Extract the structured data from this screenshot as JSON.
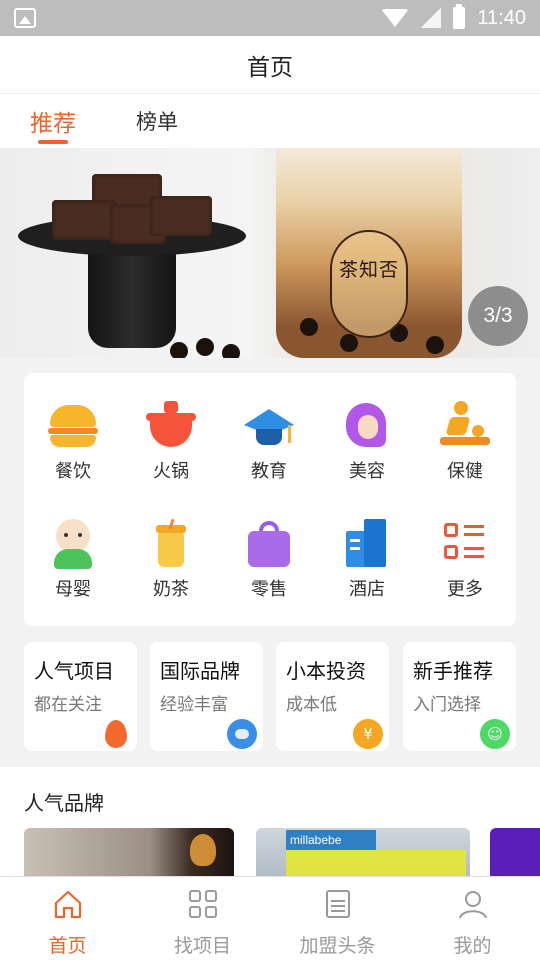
{
  "status_bar": {
    "time": "11:40",
    "icons": [
      "image-icon",
      "wifi-icon",
      "no-signal-icon",
      "battery-charging-icon"
    ]
  },
  "header": {
    "title": "首页"
  },
  "tabs": [
    {
      "label": "推荐",
      "active": true
    },
    {
      "label": "榜单",
      "active": false
    }
  ],
  "banner": {
    "indicator": "3/3",
    "cup_text": "茶知否"
  },
  "categories": [
    {
      "label": "餐饮",
      "icon": "burger-icon"
    },
    {
      "label": "火锅",
      "icon": "hotpot-icon"
    },
    {
      "label": "教育",
      "icon": "graduation-cap-icon"
    },
    {
      "label": "美容",
      "icon": "beauty-icon"
    },
    {
      "label": "保健",
      "icon": "massage-icon"
    },
    {
      "label": "母婴",
      "icon": "baby-icon"
    },
    {
      "label": "奶茶",
      "icon": "milk-tea-icon"
    },
    {
      "label": "零售",
      "icon": "shopping-bag-icon"
    },
    {
      "label": "酒店",
      "icon": "hotel-icon"
    },
    {
      "label": "更多",
      "icon": "more-list-icon"
    }
  ],
  "features": [
    {
      "title": "人气项目",
      "subtitle": "都在关注",
      "icon": "flame-icon",
      "color": "#f26a2e"
    },
    {
      "title": "国际品牌",
      "subtitle": "经验丰富",
      "icon": "globe-icon",
      "color": "#3a8ee6"
    },
    {
      "title": "小本投资",
      "subtitle": "成本低",
      "icon": "yen-coin-icon",
      "color": "#f5a623"
    },
    {
      "title": "新手推荐",
      "subtitle": "入门选择",
      "icon": "smile-icon",
      "color": "#4cd964"
    }
  ],
  "brands": {
    "title": "人气品牌",
    "card2_sign": "millabebe"
  },
  "bottom_nav": [
    {
      "label": "首页",
      "icon": "home-icon",
      "active": true
    },
    {
      "label": "找项目",
      "icon": "grid-icon",
      "active": false
    },
    {
      "label": "加盟头条",
      "icon": "news-icon",
      "active": false
    },
    {
      "label": "我的",
      "icon": "user-icon",
      "active": false
    }
  ],
  "colors": {
    "accent": "#f0632b",
    "inactive": "#999999"
  }
}
